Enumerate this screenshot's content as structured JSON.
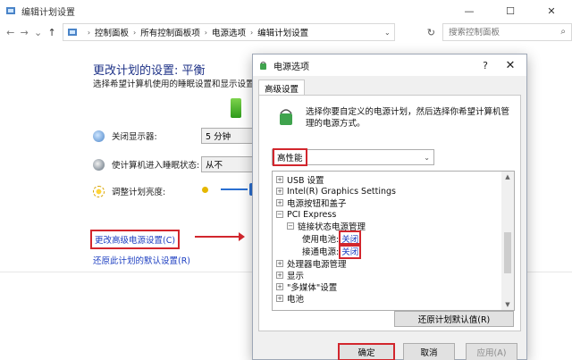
{
  "window": {
    "title": "编辑计划设置",
    "min_label": "—",
    "max_label": "☐",
    "close_label": "✕"
  },
  "nav": {
    "back": "←",
    "forward": "→",
    "recent": "⌄",
    "up": "↑",
    "breadcrumbs": [
      "控制面板",
      "所有控制面板项",
      "电源选项",
      "编辑计划设置"
    ],
    "search_placeholder": "搜索控制面板"
  },
  "plan": {
    "heading": "更改计划的设置: 平衡",
    "subtitle": "选择希望计算机使用的睡眠设置和显示设置。",
    "display_label": "关闭显示器:",
    "display_value": "5 分钟",
    "sleep_label": "使计算机进入睡眠状态:",
    "sleep_value": "从不",
    "brightness_label": "调整计划亮度:",
    "brightness_level": 0.6,
    "advanced_link": "更改高级电源设置(C)",
    "restore_link": "还原此计划的默认设置(R)"
  },
  "dialog": {
    "title": "电源选项",
    "help": "?",
    "close": "✕",
    "tab": "高级设置",
    "description": "选择你要自定义的电源计划，然后选择你希望计算机管理的电源方式。",
    "plan_value": "高性能",
    "tree": [
      {
        "sign": "+",
        "label": "USB 设置",
        "level": 0
      },
      {
        "sign": "+",
        "label": "Intel(R) Graphics Settings",
        "level": 0
      },
      {
        "sign": "+",
        "label": "电源按钮和盖子",
        "level": 0
      },
      {
        "sign": "−",
        "label": "PCI Express",
        "level": 0
      },
      {
        "sign": "−",
        "label": "链接状态电源管理",
        "level": 1
      },
      {
        "sign": "",
        "label": "使用电池:",
        "value": "关闭",
        "level": 2
      },
      {
        "sign": "",
        "label": "接通电源:",
        "value": "关闭",
        "level": 2
      },
      {
        "sign": "+",
        "label": "处理器电源管理",
        "level": 0
      },
      {
        "sign": "+",
        "label": "显示",
        "level": 0
      },
      {
        "sign": "+",
        "label": "\"多媒体\"设置",
        "level": 0
      },
      {
        "sign": "+",
        "label": "电池",
        "level": 0
      }
    ],
    "restore_defaults": "还原计划默认值(R)",
    "ok": "确定",
    "cancel": "取消",
    "apply": "应用(A)"
  },
  "colors": {
    "highlight": "#d2262d",
    "link": "#1c3ec1",
    "heading": "#1e3287"
  }
}
